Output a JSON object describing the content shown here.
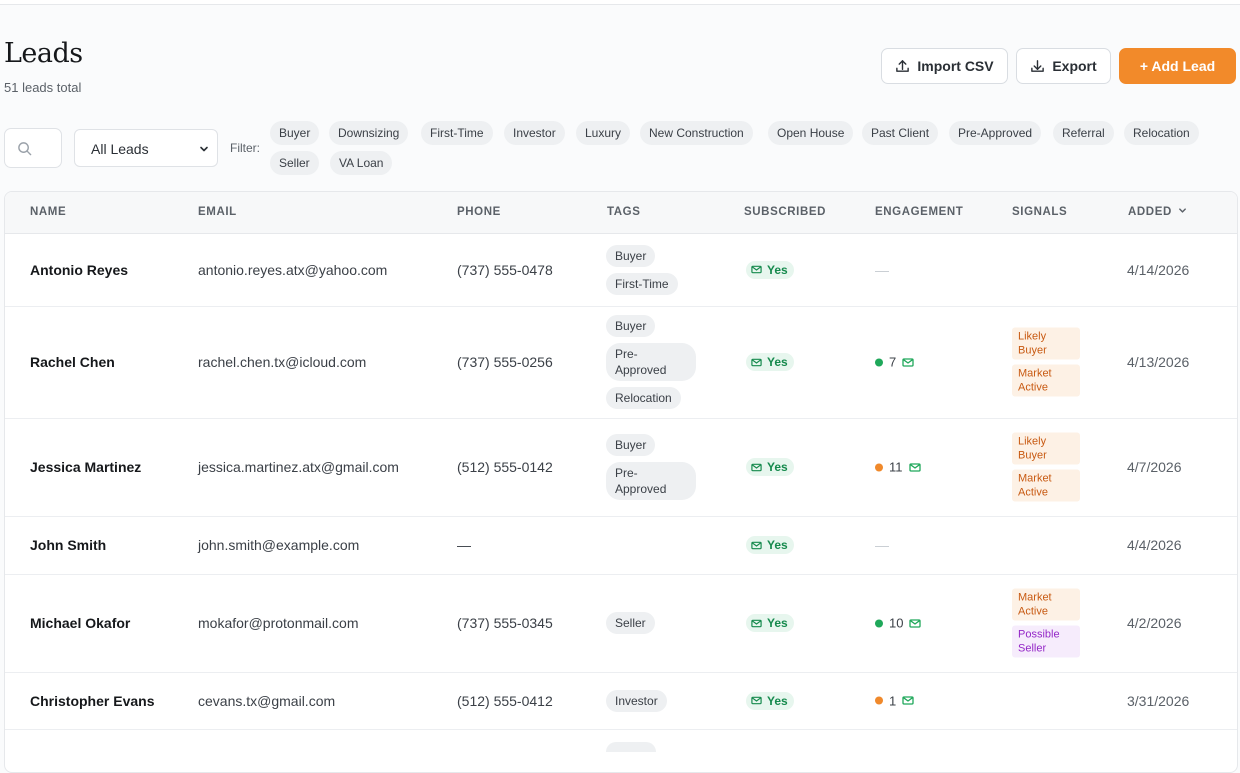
{
  "header": {
    "title": "Leads",
    "subtitle": "51 leads total",
    "import_label": "Import CSV",
    "export_label": "Export",
    "add_label": "+ Add Lead"
  },
  "toolbar": {
    "select_value": "All Leads",
    "filter_label": "Filter:",
    "chips": [
      "Buyer",
      "Downsizing",
      "First-Time",
      "Investor",
      "Luxury",
      "New Construction",
      "Open House",
      "Past Client",
      "Pre-Approved",
      "Referral",
      "Relocation",
      "Seller",
      "VA Loan"
    ]
  },
  "columns": [
    "NAME",
    "EMAIL",
    "PHONE",
    "TAGS",
    "SUBSCRIBED",
    "ENGAGEMENT",
    "SIGNALS",
    "ADDED"
  ],
  "colors": {
    "accent": "#f28a2a",
    "subscribed_green": "#168a4d",
    "engagement_green": "#1fa85a",
    "engagement_orange": "#f0892b",
    "signal_orange": "#c85a12",
    "signal_purple": "#9427c7"
  },
  "leads": [
    {
      "name": "Antonio Reyes",
      "email": "antonio.reyes.atx@yahoo.com",
      "phone": "(737) 555-0478",
      "tags": [
        "Buyer",
        "First-Time"
      ],
      "subscribed": "Yes",
      "engagement": "—",
      "signals": [],
      "added": "4/14/2026"
    },
    {
      "name": "Rachel Chen",
      "email": "rachel.chen.tx@icloud.com",
      "phone": "(737) 555-0256",
      "tags": [
        "Buyer",
        "Pre-Approved",
        "Relocation"
      ],
      "subscribed": "Yes",
      "engagement": "7",
      "signals": [
        "Likely Buyer",
        "Market Active"
      ],
      "added": "4/13/2026"
    },
    {
      "name": "Jessica Martinez",
      "email": "jessica.martinez.atx@gmail.com",
      "phone": "(512) 555-0142",
      "tags": [
        "Buyer",
        "Pre-Approved"
      ],
      "subscribed": "Yes",
      "engagement": "11",
      "signals": [
        "Likely Buyer",
        "Market Active"
      ],
      "added": "4/7/2026"
    },
    {
      "name": "John Smith",
      "email": "john.smith@example.com",
      "phone": "—",
      "tags": [],
      "subscribed": "Yes",
      "engagement": "—",
      "signals": [],
      "added": "4/4/2026"
    },
    {
      "name": "Michael Okafor",
      "email": "mokafor@protonmail.com",
      "phone": "(737) 555-0345",
      "tags": [
        "Seller"
      ],
      "subscribed": "Yes",
      "engagement": "10",
      "signals": [
        "Market Active",
        "Possible Seller"
      ],
      "added": "4/2/2026"
    },
    {
      "name": "Christopher Evans",
      "email": "cevans.tx@gmail.com",
      "phone": "(512) 555-0412",
      "tags": [
        "Investor"
      ],
      "subscribed": "Yes",
      "engagement": "1",
      "signals": [],
      "added": "3/31/2026"
    }
  ]
}
